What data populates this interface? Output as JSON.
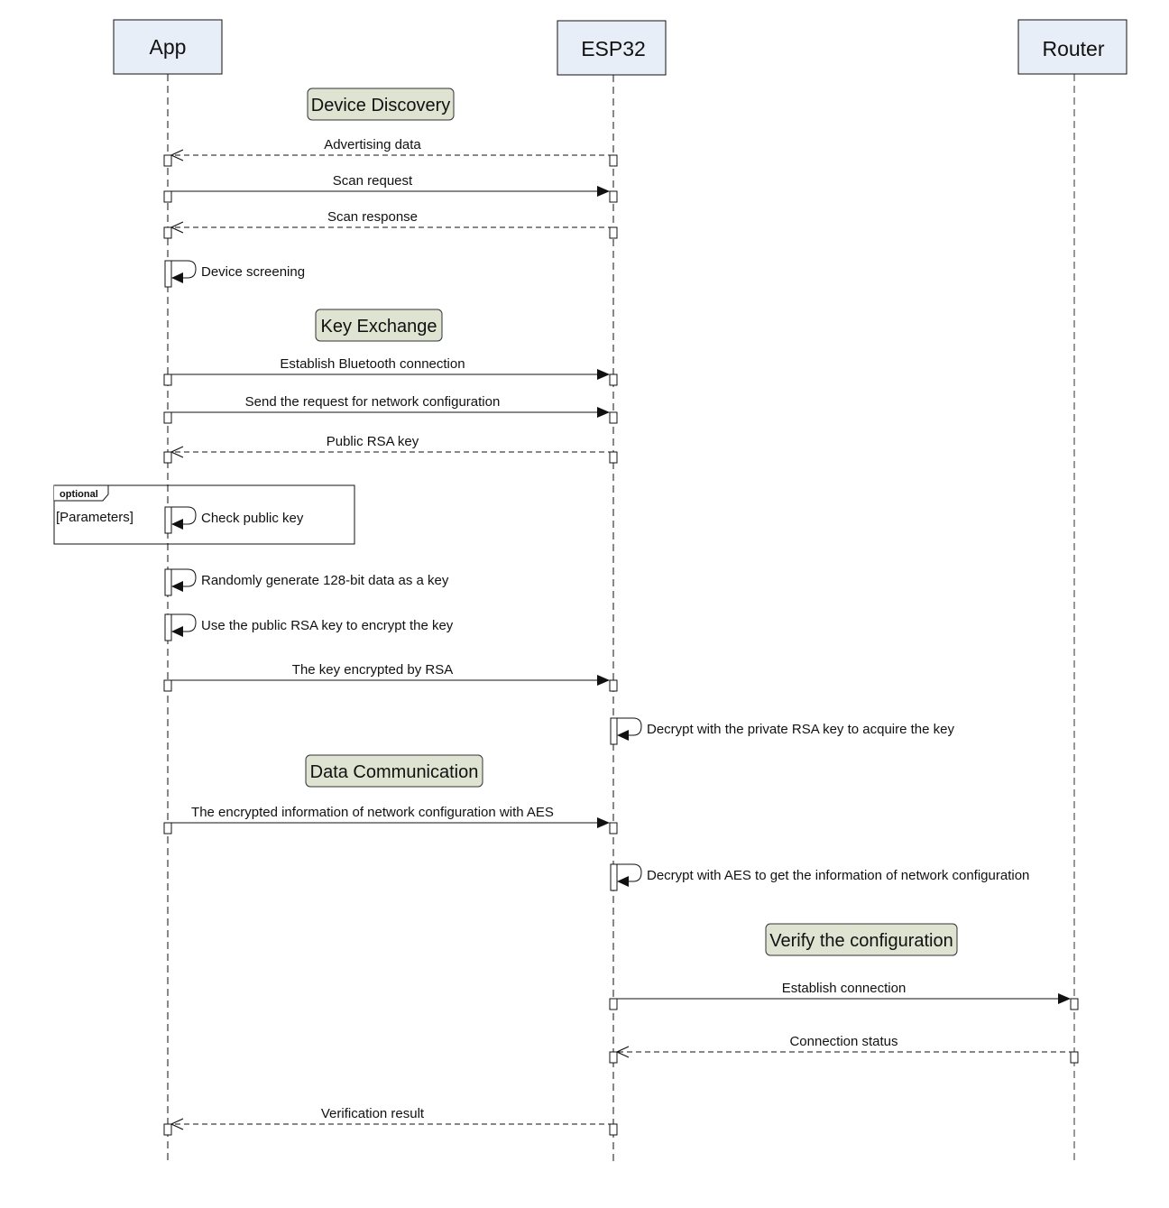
{
  "diagram": {
    "type": "sequence",
    "participants": [
      {
        "id": "app",
        "label": "App"
      },
      {
        "id": "esp32",
        "label": "ESP32"
      },
      {
        "id": "router",
        "label": "Router"
      }
    ],
    "sections": [
      {
        "label": "Device Discovery"
      },
      {
        "label": "Key Exchange"
      },
      {
        "label": "Data Communication"
      },
      {
        "label": "Verify the configuration"
      }
    ],
    "messages": [
      {
        "label": "Advertising data",
        "from": "esp32",
        "to": "app",
        "style": "dashed"
      },
      {
        "label": "Scan request",
        "from": "app",
        "to": "esp32",
        "style": "solid"
      },
      {
        "label": "Scan response",
        "from": "esp32",
        "to": "app",
        "style": "dashed"
      },
      {
        "label": "Device screening",
        "from": "app",
        "to": "app",
        "style": "self"
      },
      {
        "label": "Establish Bluetooth connection",
        "from": "app",
        "to": "esp32",
        "style": "solid"
      },
      {
        "label": "Send the request for network configuration",
        "from": "app",
        "to": "esp32",
        "style": "solid"
      },
      {
        "label": "Public RSA key",
        "from": "esp32",
        "to": "app",
        "style": "dashed"
      },
      {
        "label": "Check public key",
        "from": "app",
        "to": "app",
        "style": "self"
      },
      {
        "label": "Randomly generate 128-bit data as a key",
        "from": "app",
        "to": "app",
        "style": "self"
      },
      {
        "label": "Use the public RSA key to encrypt the key",
        "from": "app",
        "to": "app",
        "style": "self"
      },
      {
        "label": "The key encrypted by RSA",
        "from": "app",
        "to": "esp32",
        "style": "solid"
      },
      {
        "label": "Decrypt with the private RSA key to acquire the key",
        "from": "esp32",
        "to": "esp32",
        "style": "self"
      },
      {
        "label": "The encrypted information of network configuration with AES",
        "from": "app",
        "to": "esp32",
        "style": "solid"
      },
      {
        "label": "Decrypt with AES to get the information of network configuration",
        "from": "esp32",
        "to": "esp32",
        "style": "self"
      },
      {
        "label": "Establish connection",
        "from": "esp32",
        "to": "router",
        "style": "solid"
      },
      {
        "label": "Connection status",
        "from": "router",
        "to": "esp32",
        "style": "dashed"
      },
      {
        "label": "Verification result",
        "from": "esp32",
        "to": "app",
        "style": "dashed"
      }
    ],
    "frame": {
      "tag": "optional",
      "guard": "[Parameters]"
    },
    "colors": {
      "participant_fill": "#e8eef8",
      "section_fill": "#dfe3d2",
      "line": "#111111",
      "router_lifeline": "#777777"
    }
  }
}
